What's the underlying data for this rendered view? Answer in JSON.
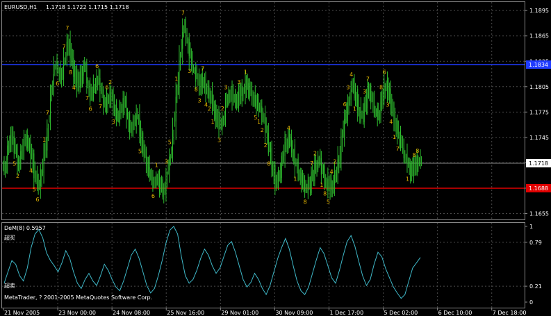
{
  "window": {
    "title": "EURUSD,H1",
    "ohlc": "1.1718 1.1722 1.1715 1.1718",
    "indicator_title": "DeM(8) 0.5957",
    "overbought_label": "超买",
    "oversold_label": "超卖",
    "copyright": "MetaTrader, ? 2001-2005 MetaQuotes Software Corp."
  },
  "colors": {
    "background": "#000000",
    "grid": "#4a4a4a",
    "candle": "#2fbf2f",
    "fractal": "#e6b800",
    "blue_line": "#1f3bff",
    "red_line": "#e00000",
    "current_line": "#8a8a8a",
    "dem_line": "#3fb8c8",
    "axis_text": "#ffffff"
  },
  "price_levels": {
    "blue": "1.1834",
    "current": "1.1718",
    "red": "1.1688"
  },
  "chart_data": [
    {
      "type": "line",
      "title": "EURUSD,H1",
      "ylim": [
        1.1648,
        1.1905
      ],
      "yticks": [
        "1.1895",
        "1.1865",
        "1.1835",
        "1.1805",
        "1.1775",
        "1.1745",
        "1.1715",
        "1.1685",
        "1.1655"
      ],
      "xticks": [
        "21 Nov 2005",
        "23 Nov 00:00",
        "24 Nov 08:00",
        "25 Nov 16:00",
        "29 Nov 01:00",
        "30 Nov 09:00",
        "1 Dec 17:00",
        "5 Dec 02:00",
        "6 Dec 10:00",
        "7 Dec 18:00"
      ],
      "grid": true,
      "series": [
        {
          "values": [
            1.1712,
            1.1735,
            1.1745,
            1.173,
            1.1716,
            1.1728,
            1.1742,
            1.1738,
            1.1722,
            1.17,
            1.1688,
            1.1705,
            1.1728,
            1.176,
            1.18,
            1.183,
            1.1825,
            1.1818,
            1.1838,
            1.186,
            1.1838,
            1.182,
            1.1808,
            1.1818,
            1.183,
            1.1808,
            1.1795,
            1.1805,
            1.1815,
            1.1798,
            1.1785,
            1.179,
            1.1796,
            1.178,
            1.177,
            1.1778,
            1.1788,
            1.177,
            1.1752,
            1.1762,
            1.1772,
            1.1745,
            1.1728,
            1.1712,
            1.17,
            1.1692,
            1.1698,
            1.1688,
            1.168,
            1.1702,
            1.1725,
            1.1755,
            1.18,
            1.1845,
            1.1878,
            1.186,
            1.184,
            1.1825,
            1.1818,
            1.1805,
            1.1812,
            1.18,
            1.1795,
            1.178,
            1.1768,
            1.1758,
            1.1765,
            1.179,
            1.1798,
            1.1792,
            1.179,
            1.1796,
            1.18,
            1.1808,
            1.18,
            1.1794,
            1.1785,
            1.178,
            1.177,
            1.1752,
            1.173,
            1.1708,
            1.1692,
            1.17,
            1.172,
            1.1738,
            1.1742,
            1.173,
            1.1712,
            1.17,
            1.1692,
            1.1685,
            1.169,
            1.17,
            1.1712,
            1.1718,
            1.1705,
            1.1695,
            1.1685,
            1.169,
            1.1702,
            1.172,
            1.1745,
            1.177,
            1.179,
            1.1805,
            1.1795,
            1.1778,
            1.177,
            1.1785,
            1.18,
            1.179,
            1.1775,
            1.177,
            1.179,
            1.1808,
            1.18,
            1.178,
            1.1762,
            1.1748,
            1.1735,
            1.1722,
            1.1712,
            1.1705,
            1.171,
            1.1715,
            1.1718
          ]
        }
      ]
    },
    {
      "type": "line",
      "title": "DeM(8) 0.5957",
      "ylim": [
        0,
        1
      ],
      "yticks": [
        "1",
        "0.79",
        "0.21",
        "0"
      ],
      "grid": true,
      "series": [
        {
          "values": [
            0.25,
            0.4,
            0.55,
            0.5,
            0.35,
            0.28,
            0.45,
            0.72,
            0.9,
            0.96,
            0.85,
            0.65,
            0.55,
            0.48,
            0.4,
            0.52,
            0.68,
            0.58,
            0.4,
            0.25,
            0.18,
            0.3,
            0.38,
            0.28,
            0.22,
            0.35,
            0.5,
            0.42,
            0.3,
            0.2,
            0.15,
            0.28,
            0.45,
            0.62,
            0.7,
            0.58,
            0.4,
            0.22,
            0.12,
            0.18,
            0.35,
            0.55,
            0.78,
            0.95,
            1.0,
            0.9,
            0.6,
            0.35,
            0.25,
            0.3,
            0.42,
            0.58,
            0.7,
            0.62,
            0.48,
            0.38,
            0.45,
            0.6,
            0.75,
            0.8,
            0.66,
            0.48,
            0.3,
            0.2,
            0.26,
            0.38,
            0.3,
            0.18,
            0.1,
            0.22,
            0.4,
            0.58,
            0.72,
            0.84,
            0.7,
            0.48,
            0.28,
            0.15,
            0.1,
            0.2,
            0.38,
            0.56,
            0.72,
            0.64,
            0.48,
            0.32,
            0.25,
            0.42,
            0.62,
            0.8,
            0.88,
            0.74,
            0.54,
            0.35,
            0.22,
            0.3,
            0.5,
            0.66,
            0.6,
            0.44,
            0.32,
            0.2,
            0.12,
            0.05,
            0.1,
            0.28,
            0.45,
            0.52,
            0.59
          ]
        }
      ]
    }
  ]
}
